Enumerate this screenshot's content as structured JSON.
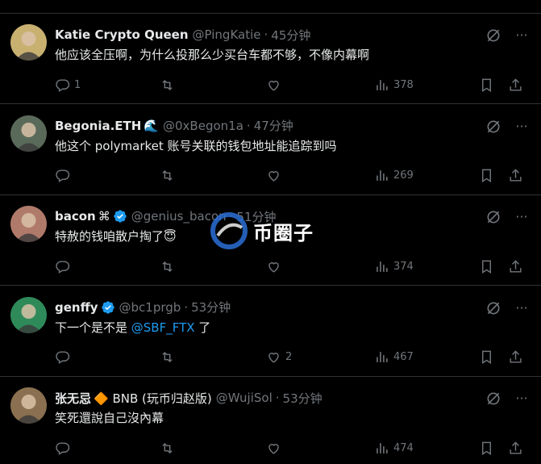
{
  "watermark": {
    "text": "币圈子"
  },
  "tweets": [
    {
      "name": "Katie Crypto Queen",
      "name_extra": "",
      "handle": "@PingKatie",
      "time": "45分钟",
      "text": "他应该全压啊，为什么投那么少买台车都不够，不像内幕啊",
      "mention": "",
      "text_after": "",
      "replies": "1",
      "retweets": "",
      "likes": "",
      "views": "378",
      "verified": false,
      "avatar_color": "#c8b070"
    },
    {
      "name": "Begonia.ETH",
      "name_extra": "🌊",
      "handle": "@0xBegon1a",
      "time": "47分钟",
      "text": "他这个 polymarket 账号关联的钱包地址能追踪到吗",
      "mention": "",
      "text_after": "",
      "replies": "",
      "retweets": "",
      "likes": "",
      "views": "269",
      "verified": false,
      "avatar_color": "#5a6a5a"
    },
    {
      "name": "bacon",
      "name_extra": "⌘",
      "handle": "@genius_bacon",
      "time": "51分钟",
      "text": "特赦的钱咱散户掏了😇",
      "mention": "",
      "text_after": "",
      "replies": "",
      "retweets": "",
      "likes": "",
      "views": "374",
      "verified": true,
      "avatar_color": "#b07a6a"
    },
    {
      "name": "genffy",
      "name_extra": "",
      "handle": "@bc1prgb",
      "time": "53分钟",
      "text": "下一个是不是 ",
      "mention": "@SBF_FTX",
      "text_after": " 了",
      "replies": "",
      "retweets": "",
      "likes": "2",
      "views": "467",
      "verified": true,
      "avatar_color": "#2f8a5a"
    },
    {
      "name": "张无忌",
      "name_extra": "🔶 BNB (玩币归赵版)",
      "handle": "@WujiSol",
      "time": "53分钟",
      "text": "笑死還說自己沒內幕",
      "mention": "",
      "text_after": "",
      "replies": "",
      "retweets": "",
      "likes": "",
      "views": "474",
      "verified": false,
      "avatar_color": "#8a7050"
    }
  ],
  "colors": {
    "accent": "#1d9bf0",
    "muted": "#71767b",
    "border": "#2f3336",
    "text": "#e7e9ea"
  }
}
